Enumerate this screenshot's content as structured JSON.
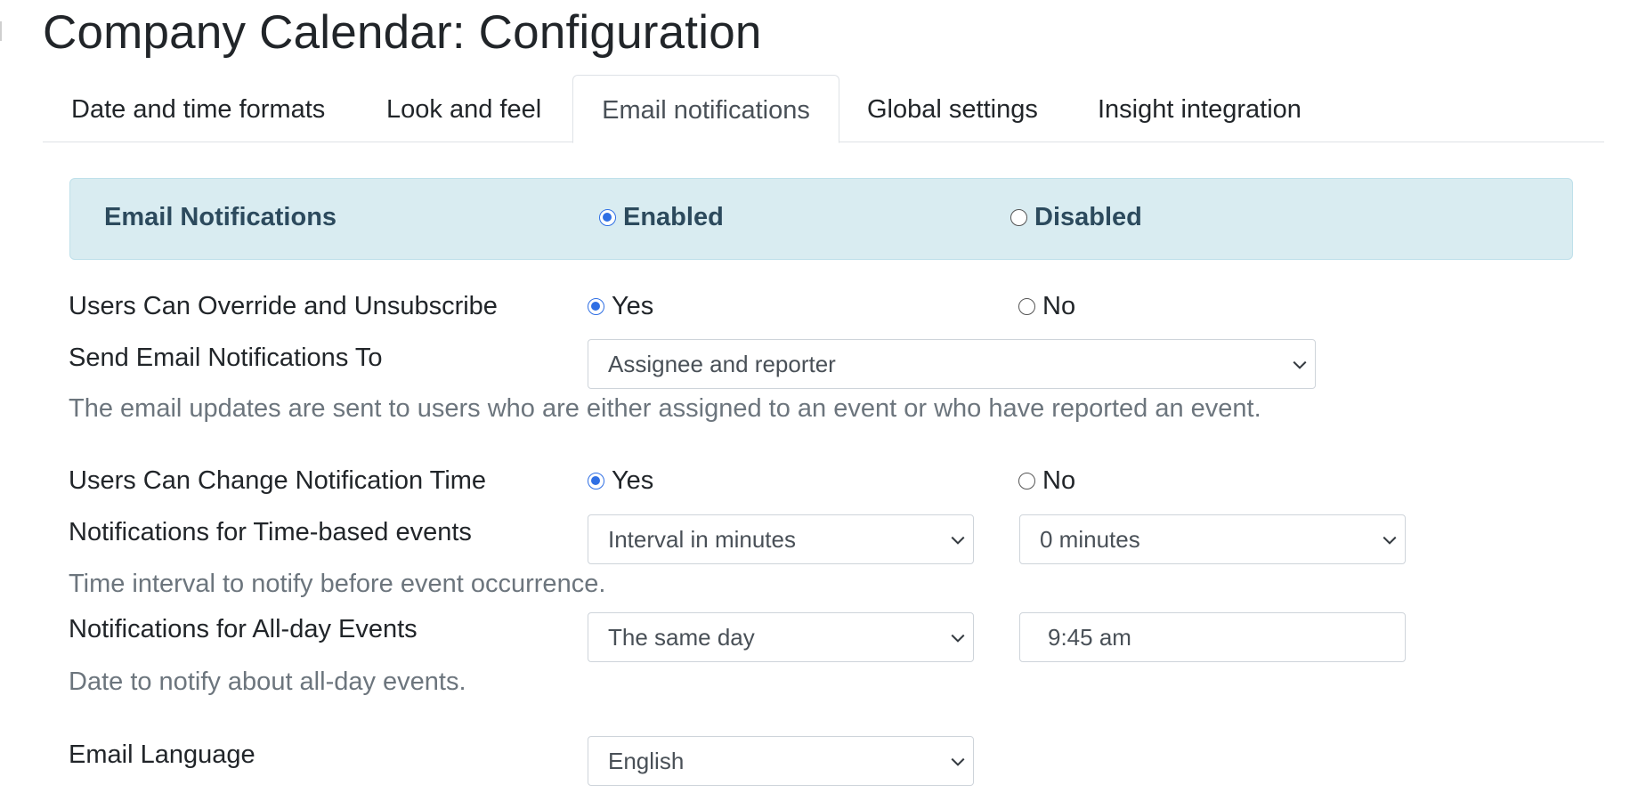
{
  "page": {
    "title": "Company Calendar: Configuration"
  },
  "tabs": [
    {
      "label": "Date and time formats"
    },
    {
      "label": "Look and feel"
    },
    {
      "label": "Email notifications",
      "active": true
    },
    {
      "label": "Global settings"
    },
    {
      "label": "Insight integration"
    }
  ],
  "email_notifications": {
    "label": "Email Notifications",
    "enabled_label": "Enabled",
    "disabled_label": "Disabled",
    "selected": "Enabled"
  },
  "override": {
    "label": "Users Can Override and Unsubscribe",
    "yes_label": "Yes",
    "no_label": "No",
    "selected": "Yes"
  },
  "send_to": {
    "label": "Send Email Notifications To",
    "value": "Assignee and reporter",
    "help": "The email updates are sent to users who are either assigned to an event or who have reported an event."
  },
  "change_time": {
    "label": "Users Can Change Notification Time",
    "yes_label": "Yes",
    "no_label": "No",
    "selected": "Yes"
  },
  "time_based": {
    "label": "Notifications for Time-based events",
    "mode_value": "Interval in minutes",
    "interval_value": "0 minutes",
    "help": "Time interval to notify before event occurrence."
  },
  "all_day": {
    "label": "Notifications for All-day Events",
    "day_value": "The same day",
    "time_value": "9:45 am",
    "help": "Date to notify about all-day events."
  },
  "language": {
    "label": "Email Language",
    "value": "English"
  },
  "colors": {
    "accent": "#2f6fe4",
    "banner_bg": "#d9ecf1",
    "banner_text": "#2c4a5d",
    "help_text": "#6c757d"
  }
}
